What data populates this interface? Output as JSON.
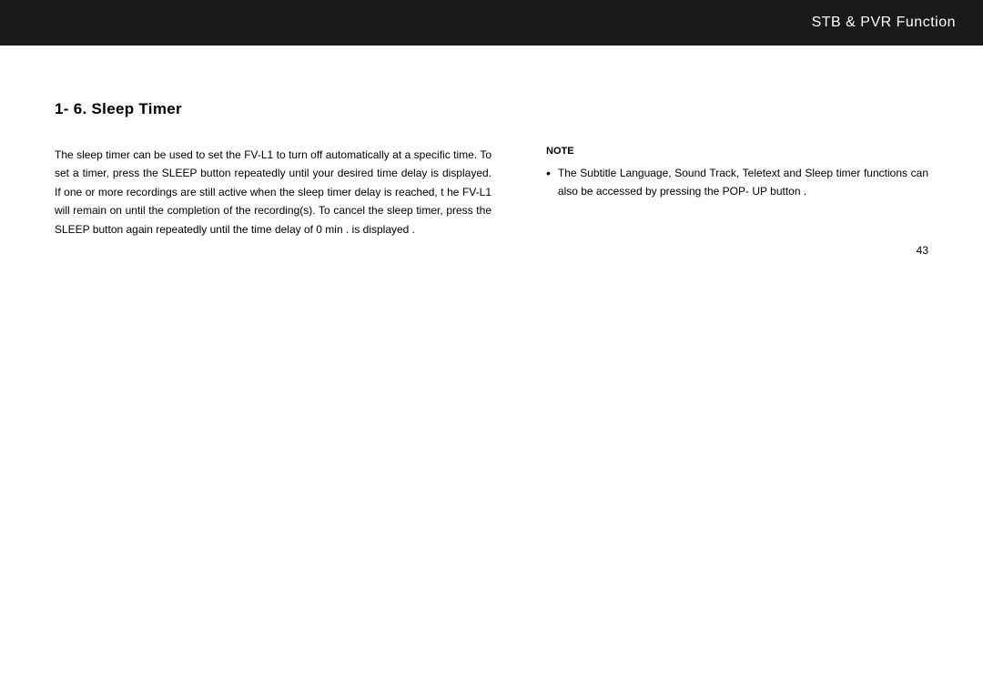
{
  "header": {
    "title": "STB & PVR Function"
  },
  "section": {
    "title": "1- 6.  Sleep  Timer"
  },
  "left_column": {
    "paragraph": "The sleep timer can be used to set the       FV-L1  to  turn off automatically at a specific  time.       To set a timer, press      the  SLEEP  button repeatedly until your desired time delay is displayed.         If one or more recordings are still active when the sleep timer delay          is reached, t  he  FV-L1  will remain on until the completion of the         recording(s).    To cancel the  sleep timer, press   the  SLEEP  button  again repeatedly    until  the  time  delay of   0 min .  is displayed   ."
  },
  "right_column": {
    "note_label": "NOTE",
    "note_text": "The  Subtitle  Language,  Sound  Track,  Teletext         and  Sleep  timer functions can also be accessed by pressing the        POP- UP  button  ."
  },
  "page_number": "43"
}
